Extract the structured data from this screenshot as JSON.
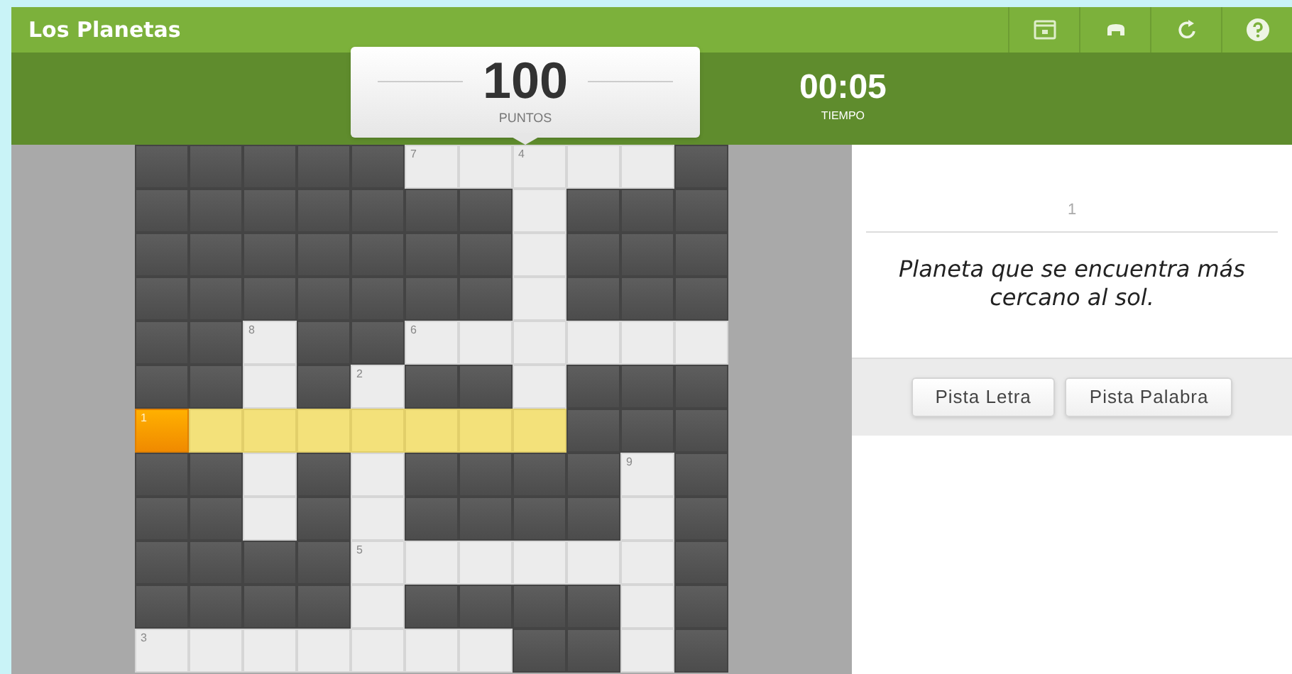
{
  "window": {
    "title": "Los Planetas"
  },
  "toolbar": [
    {
      "kind": "screen"
    },
    {
      "kind": "print"
    },
    {
      "kind": "refresh"
    },
    {
      "kind": "help"
    }
  ],
  "score": {
    "value": "100",
    "label": "PUNTOS"
  },
  "timer": {
    "value": "00:05",
    "label": "TIEMPO"
  },
  "grid": [
    [
      {
        "kind": "block"
      },
      {
        "kind": "block"
      },
      {
        "kind": "block"
      },
      {
        "kind": "block"
      },
      {
        "kind": "block"
      },
      {
        "kind": "blank",
        "number": "7"
      },
      {
        "kind": "blank"
      },
      {
        "kind": "blank",
        "number": "4"
      },
      {
        "kind": "blank"
      },
      {
        "kind": "blank"
      },
      {
        "kind": "block"
      }
    ],
    [
      {
        "kind": "block"
      },
      {
        "kind": "block"
      },
      {
        "kind": "block"
      },
      {
        "kind": "block"
      },
      {
        "kind": "block"
      },
      {
        "kind": "block"
      },
      {
        "kind": "block"
      },
      {
        "kind": "blank"
      },
      {
        "kind": "block"
      },
      {
        "kind": "block"
      },
      {
        "kind": "block"
      }
    ],
    [
      {
        "kind": "block"
      },
      {
        "kind": "block"
      },
      {
        "kind": "block"
      },
      {
        "kind": "block"
      },
      {
        "kind": "block"
      },
      {
        "kind": "block"
      },
      {
        "kind": "block"
      },
      {
        "kind": "blank"
      },
      {
        "kind": "block"
      },
      {
        "kind": "block"
      },
      {
        "kind": "block"
      }
    ],
    [
      {
        "kind": "block"
      },
      {
        "kind": "block"
      },
      {
        "kind": "block"
      },
      {
        "kind": "block"
      },
      {
        "kind": "block"
      },
      {
        "kind": "block"
      },
      {
        "kind": "block"
      },
      {
        "kind": "blank"
      },
      {
        "kind": "block"
      },
      {
        "kind": "block"
      },
      {
        "kind": "block"
      }
    ],
    [
      {
        "kind": "block"
      },
      {
        "kind": "block"
      },
      {
        "kind": "blank",
        "number": "8"
      },
      {
        "kind": "block"
      },
      {
        "kind": "block"
      },
      {
        "kind": "blank",
        "number": "6"
      },
      {
        "kind": "blank"
      },
      {
        "kind": "blank"
      },
      {
        "kind": "blank"
      },
      {
        "kind": "blank"
      },
      {
        "kind": "blank"
      }
    ],
    [
      {
        "kind": "block"
      },
      {
        "kind": "block"
      },
      {
        "kind": "blank"
      },
      {
        "kind": "block"
      },
      {
        "kind": "blank",
        "number": "2"
      },
      {
        "kind": "block"
      },
      {
        "kind": "block"
      },
      {
        "kind": "blank"
      },
      {
        "kind": "block"
      },
      {
        "kind": "block"
      },
      {
        "kind": "block"
      }
    ],
    [
      {
        "kind": "active",
        "number": "1"
      },
      {
        "kind": "highlight"
      },
      {
        "kind": "highlight"
      },
      {
        "kind": "highlight"
      },
      {
        "kind": "highlight"
      },
      {
        "kind": "highlight"
      },
      {
        "kind": "highlight"
      },
      {
        "kind": "highlight"
      },
      {
        "kind": "block"
      },
      {
        "kind": "block"
      },
      {
        "kind": "block"
      }
    ],
    [
      {
        "kind": "block"
      },
      {
        "kind": "block"
      },
      {
        "kind": "blank"
      },
      {
        "kind": "block"
      },
      {
        "kind": "blank"
      },
      {
        "kind": "block"
      },
      {
        "kind": "block"
      },
      {
        "kind": "block"
      },
      {
        "kind": "block"
      },
      {
        "kind": "blank",
        "number": "9"
      },
      {
        "kind": "block"
      }
    ],
    [
      {
        "kind": "block"
      },
      {
        "kind": "block"
      },
      {
        "kind": "blank"
      },
      {
        "kind": "block"
      },
      {
        "kind": "blank"
      },
      {
        "kind": "block"
      },
      {
        "kind": "block"
      },
      {
        "kind": "block"
      },
      {
        "kind": "block"
      },
      {
        "kind": "blank"
      },
      {
        "kind": "block"
      }
    ],
    [
      {
        "kind": "block"
      },
      {
        "kind": "block"
      },
      {
        "kind": "block"
      },
      {
        "kind": "block"
      },
      {
        "kind": "blank",
        "number": "5"
      },
      {
        "kind": "blank"
      },
      {
        "kind": "blank"
      },
      {
        "kind": "blank"
      },
      {
        "kind": "blank"
      },
      {
        "kind": "blank"
      },
      {
        "kind": "block"
      }
    ],
    [
      {
        "kind": "block"
      },
      {
        "kind": "block"
      },
      {
        "kind": "block"
      },
      {
        "kind": "block"
      },
      {
        "kind": "blank"
      },
      {
        "kind": "block"
      },
      {
        "kind": "block"
      },
      {
        "kind": "block"
      },
      {
        "kind": "block"
      },
      {
        "kind": "blank"
      },
      {
        "kind": "block"
      }
    ],
    [
      {
        "kind": "blank",
        "number": "3"
      },
      {
        "kind": "blank"
      },
      {
        "kind": "blank"
      },
      {
        "kind": "blank"
      },
      {
        "kind": "blank"
      },
      {
        "kind": "blank"
      },
      {
        "kind": "blank"
      },
      {
        "kind": "block"
      },
      {
        "kind": "block"
      },
      {
        "kind": "blank"
      },
      {
        "kind": "block"
      }
    ]
  ],
  "clue": {
    "number": "1",
    "text": "Planeta que se encuentra más cercano al sol."
  },
  "buttons": [
    "Pista Letra",
    "Pista Palabra"
  ]
}
